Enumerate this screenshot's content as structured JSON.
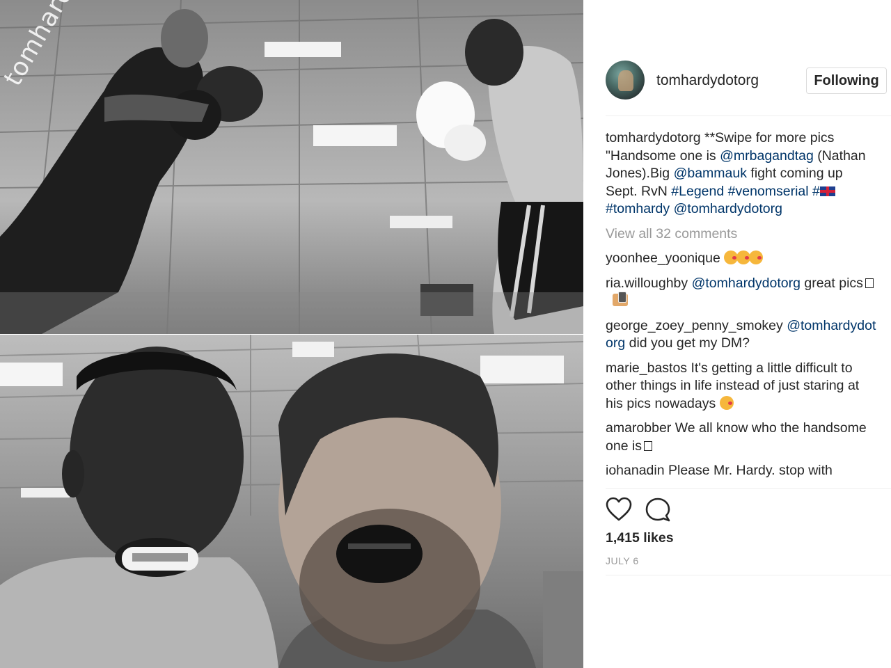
{
  "watermark": "tomhardy.org",
  "post": {
    "username": "tomhardydotorg",
    "follow_button": "Following",
    "caption": {
      "author": "tomhardydotorg",
      "text_1": " **Swipe for more pics \"Handsome one is ",
      "mention_1": "@mrbagandtag",
      "text_2": " (Nathan Jones).Big ",
      "mention_2": "@bammauk",
      "text_3": " fight coming up Sept. RvN ",
      "tag_1": "#Legend",
      "tag_2": "#venomserial",
      "tag_3": "#",
      "tag_4": "#tomhardy",
      "mention_3": "@tomhardydotorg"
    },
    "view_all": "View all 32 comments",
    "comments": [
      {
        "user": "yoonhee_yoonique",
        "text": ""
      },
      {
        "user": "ria.willoughby",
        "mention": "@tomhardydotorg",
        "text": " great pics"
      },
      {
        "user": "george_zoey_penny_smokey",
        "mention": "@tomhardydotorg",
        "text": " did you get my DM?"
      },
      {
        "user": "marie_bastos",
        "text": " It's getting a little difficult to other things in life instead of just staring at his pics nowadays"
      },
      {
        "user": "amarobber",
        "text": " We all know who the handsome one is"
      },
      {
        "user": "iohanadin",
        "text": " Please Mr. Hardy. stop with"
      }
    ],
    "likes": "1,415 likes",
    "date": "JULY 6",
    "icons": [
      "heart-icon",
      "comment-icon"
    ]
  }
}
